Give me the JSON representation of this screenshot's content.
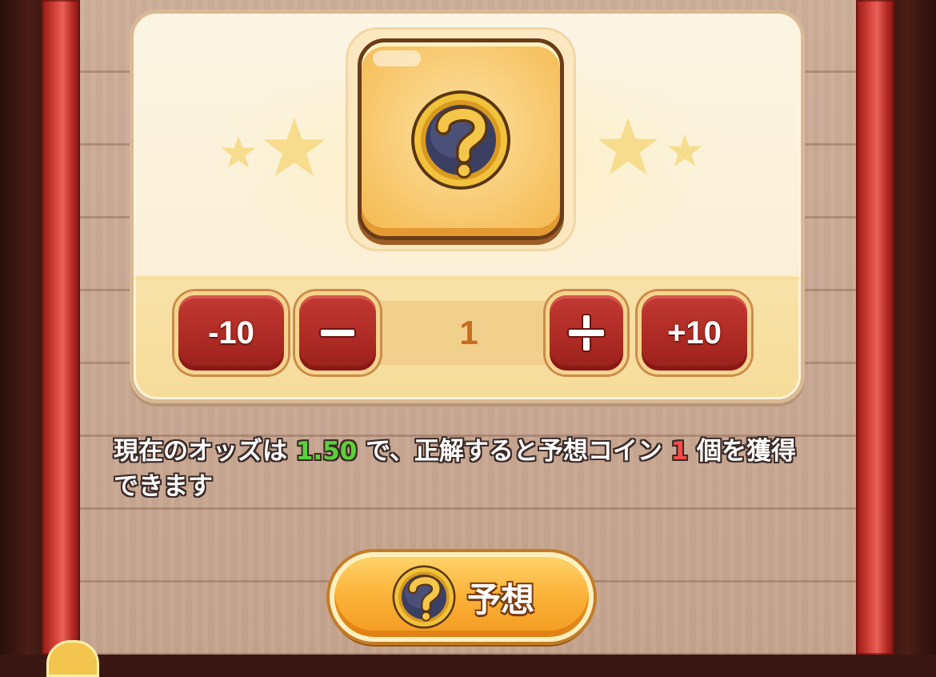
{
  "item": {
    "icon": "mystery-coin-icon"
  },
  "stepper": {
    "minus10_label": "-10",
    "minus1_symbol": "minus-icon",
    "value": "1",
    "plus1_symbol": "plus-icon",
    "plus10_label": "+10"
  },
  "description": {
    "part1": "現在のオッズは ",
    "odds": "1.50",
    "part2": " で、正解すると予想コイン ",
    "coin_count": "1",
    "part3": " 個を獲得できます"
  },
  "predict_button": {
    "label": "予想",
    "icon": "mystery-coin-icon"
  },
  "colors": {
    "odds": "#5ad13a",
    "coin_count": "#ff4a4a",
    "stepper_button": "#ad2a24",
    "predict_button": "#fbb43a",
    "pillar": "#d4423a"
  }
}
